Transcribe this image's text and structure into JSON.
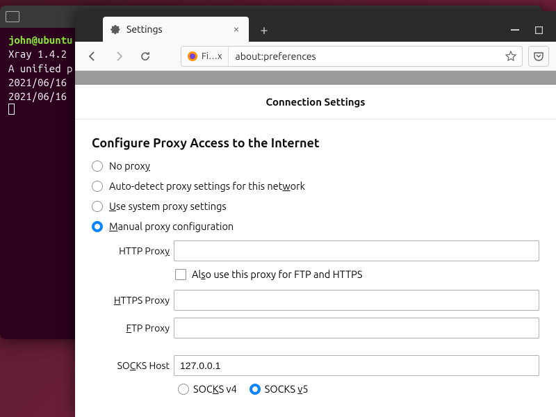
{
  "terminal": {
    "prompt": "john@ubuntu",
    "lines": [
      "Xray 1.4.2",
      "A unified p",
      "2021/06/16",
      "2021/06/16"
    ]
  },
  "browser": {
    "tab_title": "Settings",
    "identity_text": "Fi…x",
    "url": "about:preferences"
  },
  "dialog": {
    "header": "Connection Settings",
    "section_title": "Configure Proxy Access to the Internet",
    "options": {
      "no_proxy": "No prox",
      "no_proxy_u": "y",
      "auto_detect_pre": "Auto-detect proxy settings for this net",
      "auto_detect_u": "w",
      "auto_detect_post": "ork",
      "system_u": "U",
      "system_post": "se system proxy settings",
      "manual_u": "M",
      "manual_post": "anual proxy configuration"
    },
    "labels": {
      "http": "HTTP Prox",
      "http_u": "y",
      "also_pre": "Al",
      "also_u": "s",
      "also_post": "o use this proxy for FTP and HTTPS",
      "https_u": "H",
      "https_post": "TTPS Proxy",
      "ftp_u": "F",
      "ftp_post": "TP Proxy",
      "socks_pre": "SO",
      "socks_u": "C",
      "socks_post": "KS Host",
      "socks4_pre": "SOC",
      "socks4_u": "K",
      "socks4_post": "S v4",
      "socks5_pre": "SOCKS ",
      "socks5_u": "v",
      "socks5_post": "5"
    },
    "values": {
      "http": "",
      "https": "",
      "ftp": "",
      "socks": "127.0.0.1"
    }
  }
}
